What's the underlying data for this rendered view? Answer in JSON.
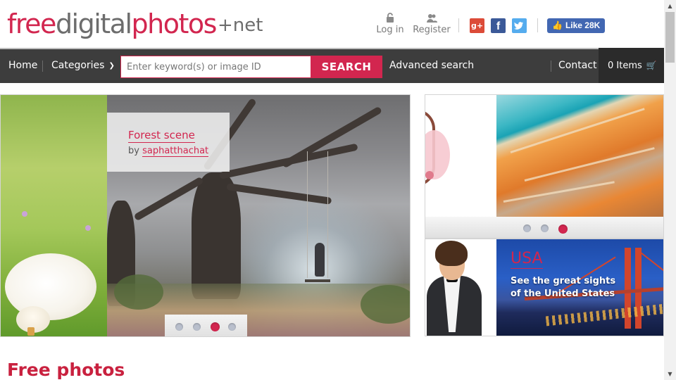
{
  "logo": {
    "part1": "free",
    "part2": "digital",
    "part3": "photos",
    "part4": "+net"
  },
  "header": {
    "login_label": "Log in",
    "register_label": "Register",
    "social": {
      "gplus": "g+",
      "facebook": "f",
      "twitter": "t"
    },
    "like_label": "Like 28K"
  },
  "nav": {
    "home": "Home",
    "categories": "Categories",
    "search_placeholder": "Enter keyword(s) or image ID",
    "search_button": "SEARCH",
    "advanced_search": "Advanced search",
    "contact": "Contact",
    "cart": "0 Items"
  },
  "slider": {
    "caption_title": "Forest scene",
    "caption_by": "by",
    "caption_author": "saphatthachat",
    "dots_count": 4,
    "active_dot": 3
  },
  "card_top": {
    "dots_count": 3,
    "active_dot": 3
  },
  "card_bottom": {
    "title": "USA",
    "subtitle": "See the great sights of the United States"
  },
  "section": {
    "title": "Free photos"
  },
  "colors": {
    "brand": "#d2264f",
    "nav_bg": "#3d3d3d",
    "facebook": "#3b5998",
    "twitter": "#55acee",
    "gplus": "#dc4b38"
  }
}
